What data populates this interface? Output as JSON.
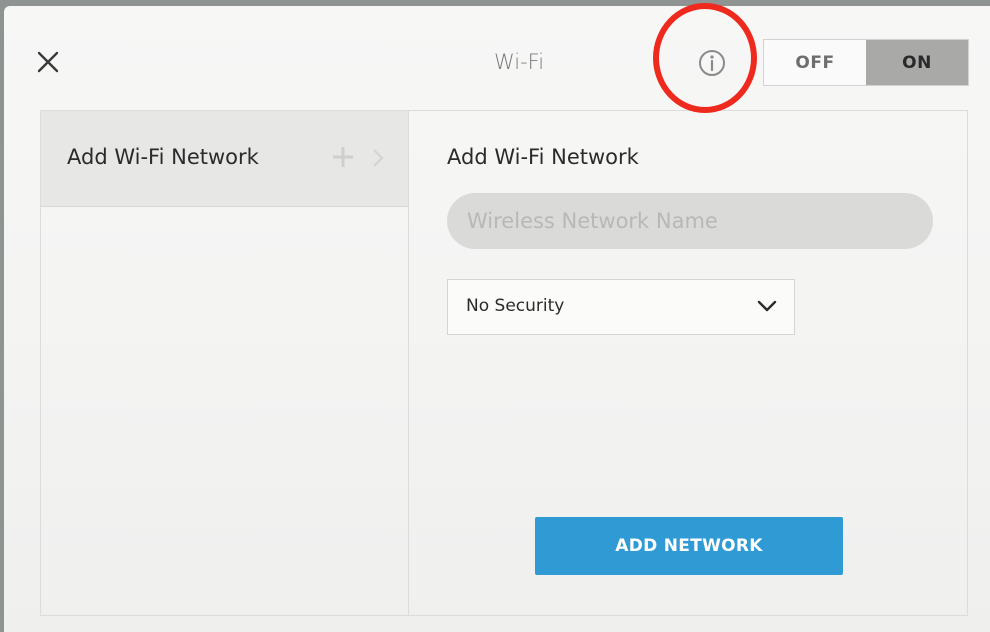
{
  "header": {
    "title": "Wi-Fi",
    "close_icon": "close-icon",
    "info_icon": "info-icon",
    "toggle": {
      "off_label": "OFF",
      "on_label": "ON",
      "selected": "ON"
    }
  },
  "annotation": {
    "color": "#ee2a1f"
  },
  "sidebar": {
    "items": [
      {
        "label": "Add Wi-Fi Network",
        "icons": [
          "plus-icon",
          "chevron-right-icon"
        ]
      }
    ]
  },
  "form": {
    "title": "Add Wi-Fi Network",
    "network_name": {
      "value": "",
      "placeholder": "Wireless Network Name"
    },
    "security": {
      "selected": "No Security"
    },
    "submit_label": "ADD NETWORK"
  },
  "colors": {
    "accent": "#2f9ad3",
    "toggle_active": "#a9a9a8"
  }
}
